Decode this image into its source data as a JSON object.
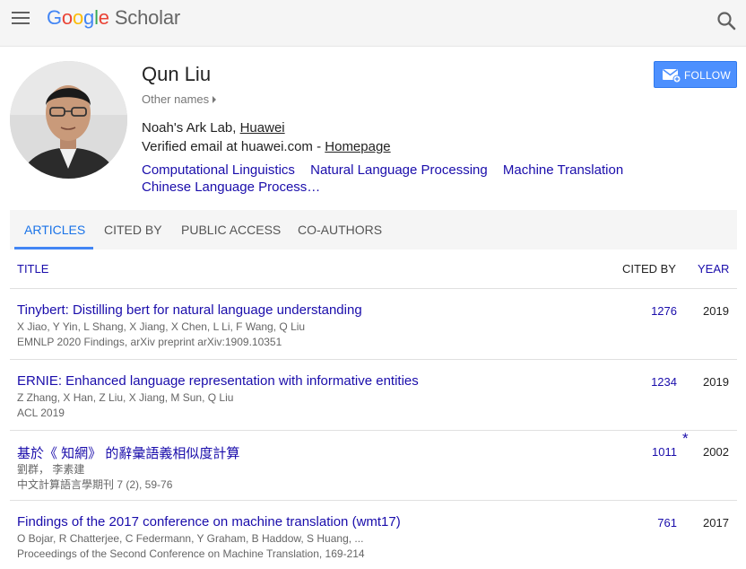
{
  "header": {
    "logo": {
      "g1": "G",
      "g2": "o",
      "g3": "o",
      "g4": "g",
      "g5": "l",
      "g6": "e",
      "scholar": "Scholar"
    }
  },
  "profile": {
    "name": "Qun Liu",
    "other_names": "Other names",
    "affiliation_prefix": "Noah's Ark Lab, ",
    "affiliation_link": "Huawei",
    "email_text": "Verified email at huawei.com - ",
    "homepage_link": "Homepage",
    "interests": [
      "Computational Linguistics",
      "Natural Language Processing",
      "Machine Translation",
      "Chinese Language Process…"
    ],
    "follow_label": "FOLLOW"
  },
  "tabs": [
    "ARTICLES",
    "CITED BY",
    "PUBLIC ACCESS",
    "CO-AUTHORS"
  ],
  "table": {
    "headers": {
      "title": "TITLE",
      "cited_by": "CITED BY",
      "year": "YEAR"
    },
    "rows": [
      {
        "title": "Tinybert: Distilling bert for natural language understanding",
        "authors": "X Jiao, Y Yin, L Shang, X Jiang, X Chen, L Li, F Wang, Q Liu",
        "venue": "EMNLP 2020 Findings, arXiv preprint arXiv:1909.10351",
        "cited_by": "1276",
        "year": "2019",
        "star": ""
      },
      {
        "title": "ERNIE: Enhanced language representation with informative entities",
        "authors": "Z Zhang, X Han, Z Liu, X Jiang, M Sun, Q Liu",
        "venue": "ACL 2019",
        "cited_by": "1234",
        "year": "2019",
        "star": ""
      },
      {
        "title": "基於《 知網》 的辭彙語義相似度計算",
        "authors": "劉群， 李素建",
        "venue": "中文計算語言學期刊 7 (2), 59-76",
        "cited_by": "1011",
        "year": "2002",
        "star": "*"
      },
      {
        "title": "Findings of the 2017 conference on machine translation (wmt17)",
        "authors": "O Bojar, R Chatterjee, C Federmann, Y Graham, B Haddow, S Huang, ...",
        "venue": "Proceedings of the Second Conference on Machine Translation, 169-214",
        "cited_by": "761",
        "year": "2017",
        "star": ""
      }
    ]
  },
  "colors": {
    "link": "#1a0dab",
    "accent": "#4285f4",
    "follow_bg": "#4d90fe"
  }
}
